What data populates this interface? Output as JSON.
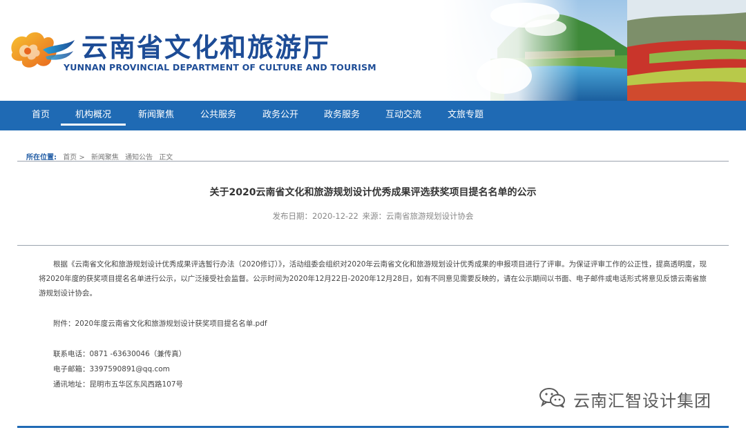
{
  "header": {
    "site_name_cn": "云南省文化和旅游厅",
    "site_name_en": "YUNNAN PROVINCIAL DEPARTMENT OF CULTURE AND TOURISM"
  },
  "nav": {
    "items": [
      {
        "label": "首页"
      },
      {
        "label": "机构概况"
      },
      {
        "label": "新闻聚焦"
      },
      {
        "label": "公共服务"
      },
      {
        "label": "政务公开"
      },
      {
        "label": "政务服务"
      },
      {
        "label": "互动交流"
      },
      {
        "label": "文旅专题"
      }
    ],
    "active_index": 1
  },
  "breadcrumb": {
    "label": "所在位置:",
    "items": [
      "首页 >",
      "新闻聚焦",
      "通知公告",
      "正文"
    ]
  },
  "article": {
    "title": "关于2020云南省文化和旅游规划设计优秀成果评选获奖项目提名名单的公示",
    "date_label": "发布日期：2020-12-22",
    "source_label": "来源：云南省旅游规划设计协会",
    "body": "根据《云南省文化和旅游规划设计优秀成果评选暂行办法（2020修订）》，活动组委会组织对2020年云南省文化和旅游规划设计优秀成果的申报项目进行了评审。为保证评审工作的公正性，提高透明度，现将2020年度的获奖项目提名名单进行公示，以广泛接受社会监督。公示时间为2020年12月22日-2020年12月28日，如有不同意见需要反映的，请在公示期间以书面、电子邮件或电话形式将意见反馈云南省旅游规划设计协会。",
    "attachment": "附件：2020年度云南省文化和旅游规划设计获奖项目提名名单.pdf",
    "contact_phone": "联系电话：0871 -63630046（兼传真）",
    "contact_email": "电子邮箱：3397590891@qq.com",
    "contact_address": "通讯地址：昆明市五华区东风西路107号"
  },
  "watermark": {
    "text": "云南汇智设计集团",
    "icon": "wechat-icon"
  },
  "colors": {
    "nav_bg": "#1f6ab4",
    "brand_blue": "#1d4c96",
    "logo_orange": "#f0a020"
  }
}
